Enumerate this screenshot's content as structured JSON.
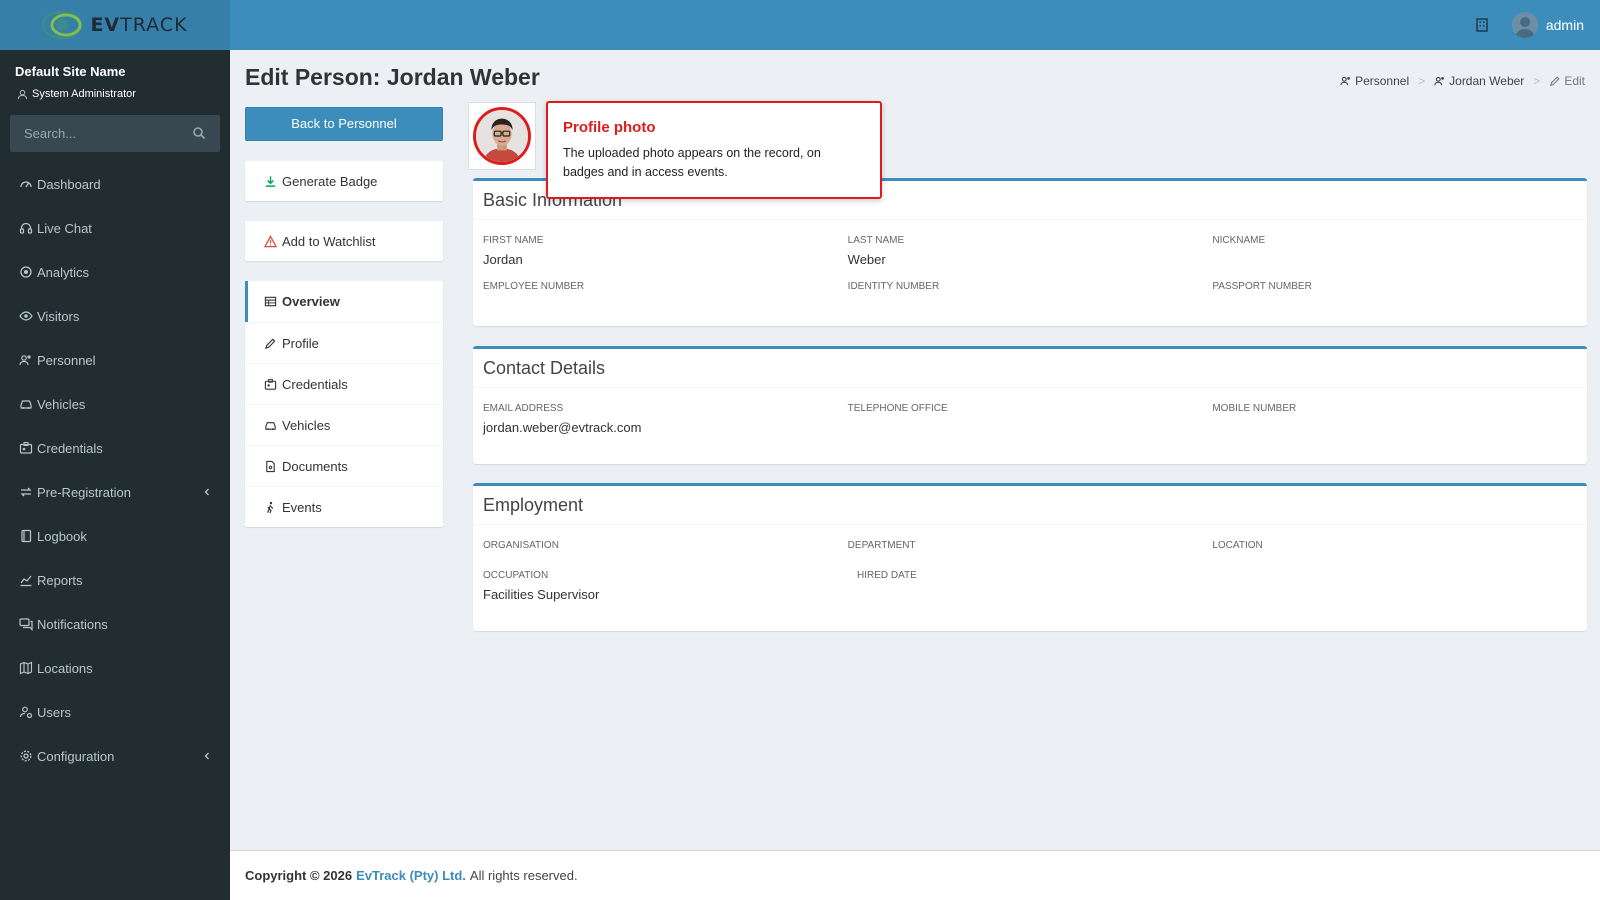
{
  "brand": {
    "logo_bold": "EV",
    "logo_light": "TRACK"
  },
  "topbar": {
    "user_name": "admin"
  },
  "sidebar": {
    "site_name": "Default Site Name",
    "role": "System Administrator",
    "search_placeholder": "Search...",
    "items": [
      {
        "label": "Dashboard",
        "icon": "dashboard-icon"
      },
      {
        "label": "Live Chat",
        "icon": "headset-icon"
      },
      {
        "label": "Analytics",
        "icon": "target-icon"
      },
      {
        "label": "Visitors",
        "icon": "eye-icon"
      },
      {
        "label": "Personnel",
        "icon": "users-icon"
      },
      {
        "label": "Vehicles",
        "icon": "car-icon"
      },
      {
        "label": "Credentials",
        "icon": "id-card-icon"
      },
      {
        "label": "Pre-Registration",
        "icon": "exchange-icon",
        "has_children": true
      },
      {
        "label": "Logbook",
        "icon": "book-icon"
      },
      {
        "label": "Reports",
        "icon": "chart-icon"
      },
      {
        "label": "Notifications",
        "icon": "comments-icon"
      },
      {
        "label": "Locations",
        "icon": "map-icon"
      },
      {
        "label": "Users",
        "icon": "user-cog-icon"
      },
      {
        "label": "Configuration",
        "icon": "gear-icon",
        "has_children": true
      }
    ]
  },
  "page": {
    "title": "Edit Person: Jordan Weber",
    "breadcrumb": [
      "Personnel",
      "Jordan Weber",
      "Edit"
    ]
  },
  "left": {
    "back_label": "Back to Personnel",
    "generate_badge": "Generate Badge",
    "add_watchlist": "Add to Watchlist",
    "nav": [
      "Overview",
      "Profile",
      "Credentials",
      "Vehicles",
      "Documents",
      "Events"
    ],
    "active_nav": "Overview"
  },
  "tooltip": {
    "title": "Profile photo",
    "body": "The uploaded photo appears on the record, on badges and in access events."
  },
  "basic": {
    "title": "Basic Information",
    "first_name_label": "FIRST NAME",
    "first_name": "Jordan",
    "last_name_label": "LAST NAME",
    "last_name": "Weber",
    "nickname_label": "NICKNAME",
    "nickname": "",
    "employee_number_label": "EMPLOYEE NUMBER",
    "employee_number": "",
    "identity_number_label": "IDENTITY NUMBER",
    "identity_number": "",
    "passport_number_label": "PASSPORT NUMBER",
    "passport_number": ""
  },
  "contact": {
    "title": "Contact Details",
    "email_label": "EMAIL ADDRESS",
    "email": "jordan.weber@evtrack.com",
    "tel_office_label": "TELEPHONE OFFICE",
    "tel_office": "",
    "mobile_label": "MOBILE NUMBER",
    "mobile": ""
  },
  "employment": {
    "title": "Employment",
    "organisation_label": "ORGANISATION",
    "organisation": "",
    "department_label": "DEPARTMENT",
    "department": "",
    "location_label": "LOCATION",
    "location": "",
    "occupation_label": "OCCUPATION",
    "occupation": "Facilities Supervisor",
    "hired_date_label": "HIRED DATE",
    "hired_date": ""
  },
  "footer": {
    "copyright": "Copyright © 2026",
    "company": "EvTrack (Pty) Ltd.",
    "rights": "All rights reserved."
  },
  "colors": {
    "primary": "#3c8dbc",
    "sidebar": "#222d32",
    "highlight": "#dd1d1d"
  }
}
